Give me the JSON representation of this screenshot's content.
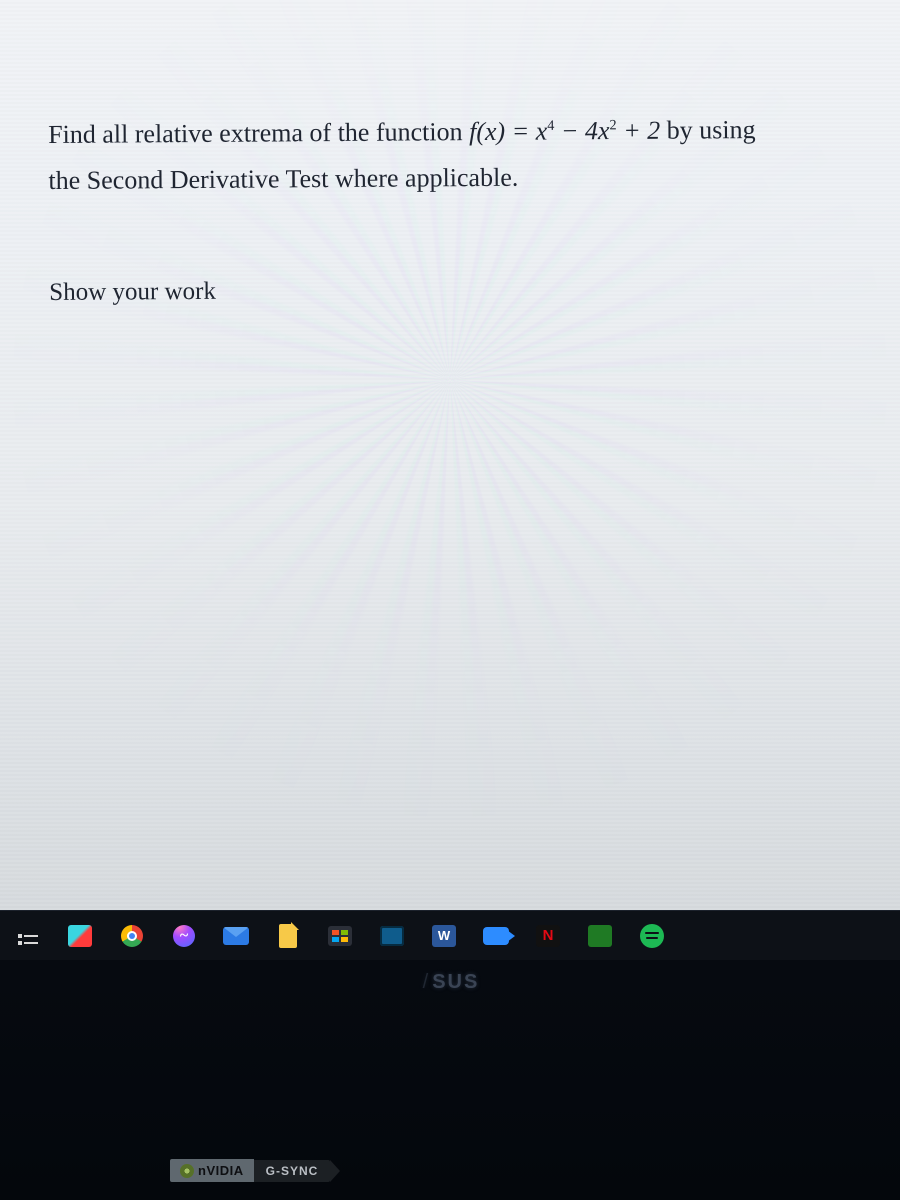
{
  "problem": {
    "line1_prefix": "Find all relative extrema of the function ",
    "fn_lhs": "f(x)",
    "equals": " = ",
    "term1_base": "x",
    "term1_exp": "4",
    "minus": " − ",
    "term2_coeff": "4",
    "term2_base": "x",
    "term2_exp": "2",
    "plus_const": " + 2",
    "line1_suffix": " by using",
    "line2": "the Second Derivative Test where applicable.",
    "prompt": "Show your work"
  },
  "taskbar": {
    "word_letter": "W",
    "netflix_letter": "N",
    "messenger_glyph": "~"
  },
  "bezel": {
    "brand_left": "/",
    "brand_text": "SUS",
    "sticker_brand": "nVIDIA",
    "sticker_tech": "G-SYNC"
  }
}
